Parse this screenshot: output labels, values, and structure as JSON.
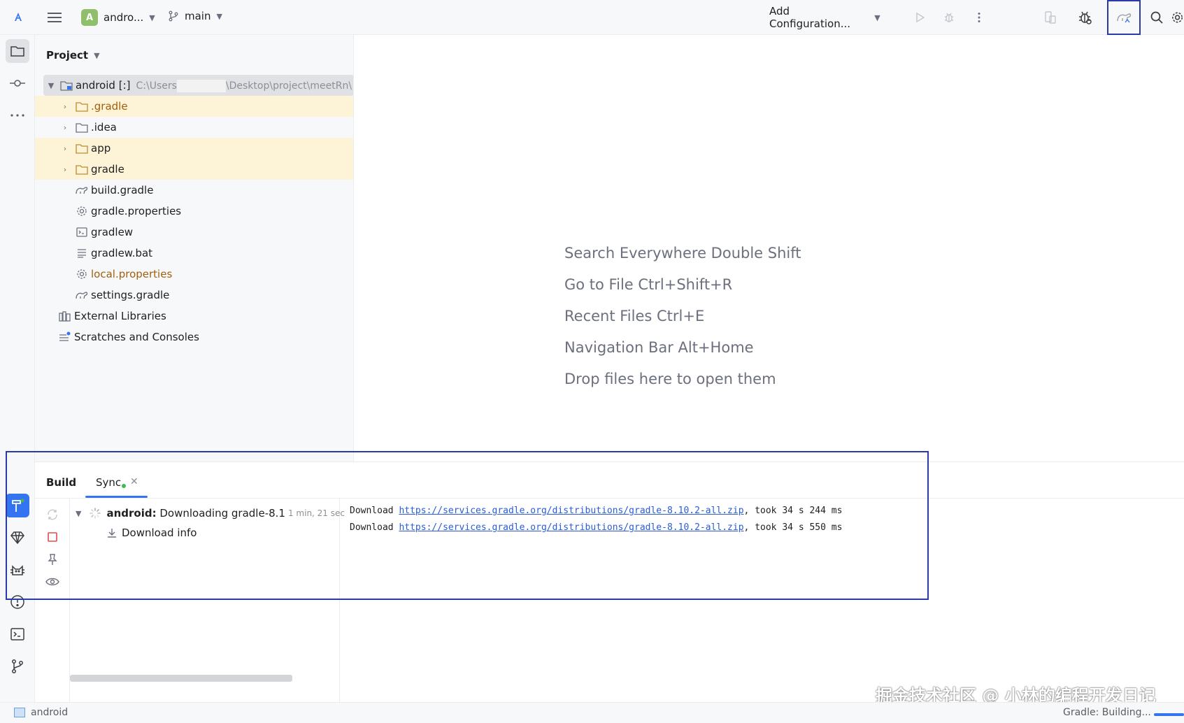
{
  "topbar": {
    "project_initial": "A",
    "project_name": "andro...",
    "branch": "main",
    "add_configuration": "Add Configuration..."
  },
  "project_panel": {
    "title": "Project",
    "root": {
      "name": "android",
      "badge": "[:]",
      "path_prefix": "C:\\Users",
      "path_suffix": "\\Desktop\\project\\meetRn\\"
    },
    "items": [
      {
        "label": ".gradle",
        "type": "folder",
        "expandable": true,
        "highlight": true,
        "orange": true
      },
      {
        "label": ".idea",
        "type": "folder",
        "expandable": true,
        "highlight": false,
        "orange": false
      },
      {
        "label": "app",
        "type": "folder",
        "expandable": true,
        "highlight": true,
        "orange": false
      },
      {
        "label": "gradle",
        "type": "folder",
        "expandable": true,
        "highlight": true,
        "orange": false
      },
      {
        "label": "build.gradle",
        "type": "gradle",
        "expandable": false,
        "highlight": false,
        "orange": false
      },
      {
        "label": "gradle.properties",
        "type": "gear",
        "expandable": false,
        "highlight": false,
        "orange": false
      },
      {
        "label": "gradlew",
        "type": "terminal",
        "expandable": false,
        "highlight": false,
        "orange": false
      },
      {
        "label": "gradlew.bat",
        "type": "text",
        "expandable": false,
        "highlight": false,
        "orange": false
      },
      {
        "label": "local.properties",
        "type": "gear",
        "expandable": false,
        "highlight": false,
        "orange": true
      },
      {
        "label": "settings.gradle",
        "type": "gradle",
        "expandable": false,
        "highlight": false,
        "orange": false
      }
    ],
    "external_libraries": "External Libraries",
    "scratches": "Scratches and Consoles"
  },
  "editor_hints": [
    "Search Everywhere Double Shift",
    "Go to File Ctrl+Shift+R",
    "Recent Files Ctrl+E",
    "Navigation Bar Alt+Home",
    "Drop files here to open them"
  ],
  "build": {
    "tab_build": "Build",
    "tab_sync": "Sync",
    "task_project": "android:",
    "task_text": "Downloading gradle-8.1",
    "task_time": "1 min, 21 sec",
    "download_info": "Download info",
    "console": [
      {
        "prefix": "Download ",
        "url": "https://services.gradle.org/distributions/gradle-8.10.2-all.zip",
        "suffix": ", took 34 s 244 ms"
      },
      {
        "prefix": "Download ",
        "url": "https://services.gradle.org/distributions/gradle-8.10.2-all.zip",
        "suffix": ", took 34 s 550 ms"
      }
    ]
  },
  "statusbar": {
    "project": "android",
    "status": "Gradle: Building..."
  },
  "watermark": "掘金技术社区 @ 小林的编程开发日记",
  "colors": {
    "accent": "#3574f0",
    "highlight_box": "#2a3aa8",
    "folder_highlight": "#fdf3d7",
    "orange_text": "#a15f0c"
  }
}
